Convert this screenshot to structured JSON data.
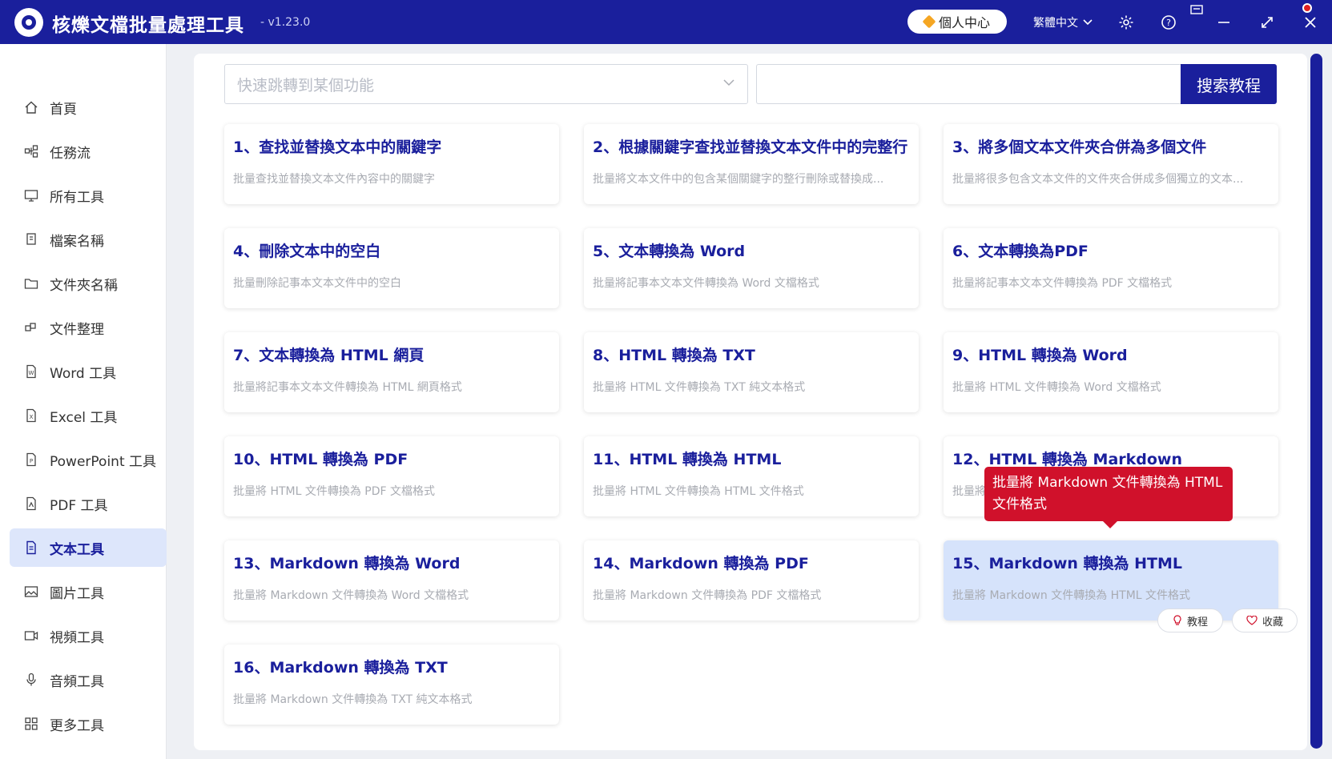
{
  "app": {
    "title": "核爍文檔批量處理工具",
    "version": "- v1.23.0"
  },
  "header": {
    "user_center": "個人中心",
    "language": "繁體中文"
  },
  "colors": {
    "primary": "#1a1f9c",
    "accent_red": "#d0112b",
    "active_card": "#d6e3fb"
  },
  "sidebar": {
    "items": [
      {
        "label": "首頁",
        "icon": "home-icon"
      },
      {
        "label": "任務流",
        "icon": "workflow-icon"
      },
      {
        "label": "所有工具",
        "icon": "monitor-icon"
      },
      {
        "label": "檔案名稱",
        "icon": "file-copy-icon"
      },
      {
        "label": "文件夾名稱",
        "icon": "folder-icon"
      },
      {
        "label": "文件整理",
        "icon": "organize-icon"
      },
      {
        "label": "Word 工具",
        "icon": "word-file-icon"
      },
      {
        "label": "Excel 工具",
        "icon": "excel-file-icon"
      },
      {
        "label": "PowerPoint 工具",
        "icon": "ppt-file-icon"
      },
      {
        "label": "PDF 工具",
        "icon": "pdf-file-icon"
      },
      {
        "label": "文本工具",
        "icon": "text-file-icon"
      },
      {
        "label": "圖片工具",
        "icon": "image-icon"
      },
      {
        "label": "視頻工具",
        "icon": "video-icon"
      },
      {
        "label": "音頻工具",
        "icon": "microphone-icon"
      },
      {
        "label": "更多工具",
        "icon": "grid-icon"
      }
    ],
    "active_index": 10
  },
  "search": {
    "jump_placeholder": "快速跳轉到某個功能",
    "search_button": "搜索教程"
  },
  "cards": [
    {
      "title": "1、查找並替換文本中的關鍵字",
      "desc": "批量查找並替換文本文件內容中的關鍵字"
    },
    {
      "title": "2、根據關鍵字查找並替換文本文件中的完整行",
      "desc": "批量將文本文件中的包含某個關鍵字的整行刪除或替換成..."
    },
    {
      "title": "3、將多個文本文件夾合併為多個文件",
      "desc": "批量將很多包含文本文件的文件夾合併成多個獨立的文本..."
    },
    {
      "title": "4、刪除文本中的空白",
      "desc": "批量刪除記事本文本文件中的空白"
    },
    {
      "title": "5、文本轉換為 Word",
      "desc": "批量將記事本文本文件轉換為 Word 文檔格式"
    },
    {
      "title": "6、文本轉換為PDF",
      "desc": "批量將記事本文本文件轉換為 PDF 文檔格式"
    },
    {
      "title": "7、文本轉換為 HTML 網頁",
      "desc": "批量將記事本文本文件轉換為 HTML 網頁格式"
    },
    {
      "title": "8、HTML 轉換為 TXT",
      "desc": "批量將 HTML 文件轉換為 TXT 純文本格式"
    },
    {
      "title": "9、HTML 轉換為 Word",
      "desc": "批量將 HTML 文件轉換為 Word 文檔格式"
    },
    {
      "title": "10、HTML 轉換為 PDF",
      "desc": "批量將 HTML 文件轉換為 PDF 文檔格式"
    },
    {
      "title": "11、HTML 轉換為 HTML",
      "desc": "批量將 HTML 文件轉換為 HTML 文件格式"
    },
    {
      "title": "12、HTML 轉換為 Markdown",
      "desc": "批量將"
    },
    {
      "title": "13、Markdown 轉換為 Word",
      "desc": "批量將 Markdown 文件轉換為 Word 文檔格式"
    },
    {
      "title": "14、Markdown 轉換為 PDF",
      "desc": "批量將 Markdown 文件轉換為 PDF 文檔格式"
    },
    {
      "title": "15、Markdown 轉換為 HTML",
      "desc": "批量將 Markdown 文件轉換為 HTML 文件格式"
    },
    {
      "title": "16、Markdown 轉換為 TXT",
      "desc": "批量將 Markdown 文件轉換為 TXT 純文本格式"
    }
  ],
  "active_card_index": 14,
  "tooltip": {
    "text": "批量將 Markdown 文件轉換為 HTML 文件格式"
  },
  "card_actions": {
    "tutorial": "教程",
    "favorite": "收藏"
  }
}
